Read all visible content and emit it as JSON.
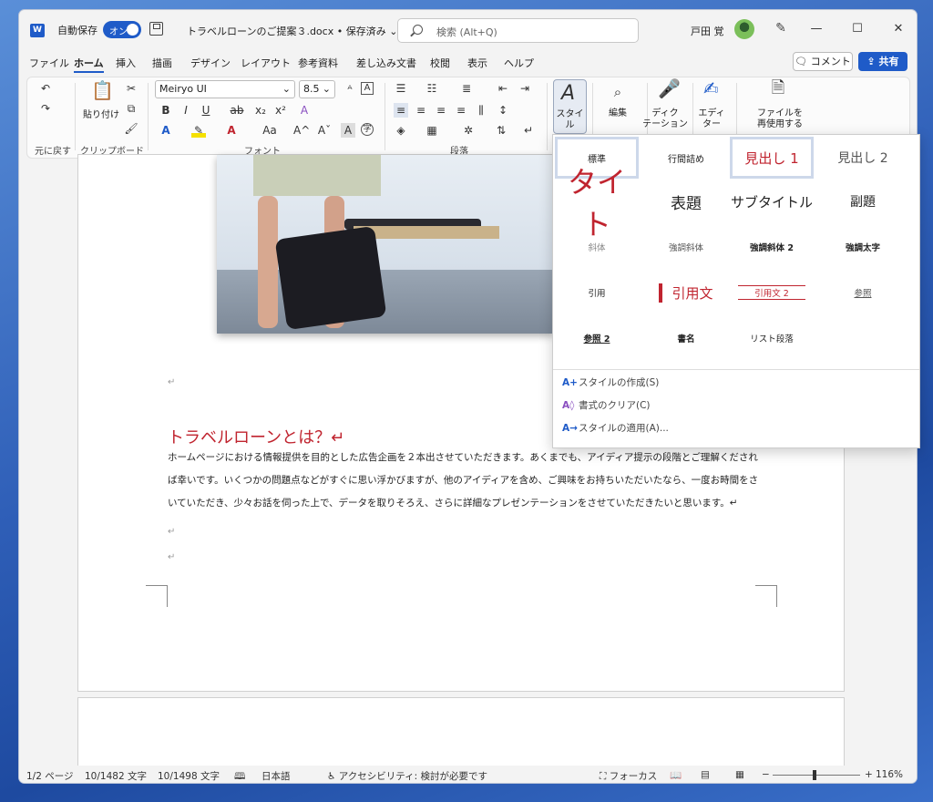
{
  "app": {
    "logo": "W",
    "autosave_label": "自動保存",
    "autosave_state": "オン",
    "doc_title": "トラベルローンのご提案３.docx • 保存済み ⌄",
    "search_placeholder": "検索 (Alt+Q)",
    "user_name": "戸田 覚"
  },
  "tabs": [
    "ファイル",
    "ホーム",
    "挿入",
    "描画",
    "デザイン",
    "レイアウト",
    "参考資料",
    "差し込み文書",
    "校閲",
    "表示",
    "ヘルプ"
  ],
  "actions": {
    "comment": "コメント",
    "share": "共有"
  },
  "ribbon": {
    "undo_group": "元に戻す",
    "paste_label": "貼り付け",
    "clipboard_group": "クリップボード",
    "font_name": "Meiryo UI",
    "font_size": "8.5",
    "font_group": "フォント",
    "paragraph_group": "段落",
    "style_label": "スタイル",
    "edit_label": "編集",
    "dictation_label": "ディク\nテーション",
    "editor_label": "エディ\nター",
    "reuse_label": "ファイルを\n再使用する"
  },
  "styles": [
    [
      "標準",
      "行間詰め",
      "見出し 1",
      "見出し 2"
    ],
    [
      "タイト",
      "表題",
      "サブタイトル",
      "副題"
    ],
    [
      "斜体",
      "強調斜体",
      "強調斜体 2",
      "強調太字"
    ],
    [
      "引用",
      "引用文",
      "引用文 2",
      "参照"
    ],
    [
      "参照 2",
      "書名",
      "リスト段落",
      ""
    ]
  ],
  "gallery_commands": [
    "スタイルの作成(S)",
    "書式のクリア(C)",
    "スタイルの適用(A)..."
  ],
  "document": {
    "heading": "トラベルローンとは？↵",
    "body": "ホームページにおける情報提供を目的とした広告企画を２本出させていただきます。あくまでも、アイディア提示の段階とご理解くだされば幸いです。いくつかの問題点などがすぐに思い浮かびますが、他のアイディアを含め、ご興味をお持ちいただいたなら、一度お時間をさいていただき、少々お話を伺った上で、データを取りそろえ、さらに詳細なプレゼンテーションをさせていただきたいと思います。↵",
    "para_mark": "↵"
  },
  "status": {
    "page": "1/2 ページ",
    "words1": "10/1482 文字",
    "words2": "10/1498 文字",
    "language": "日本語",
    "accessibility": "アクセシビリティ: 検討が必要です",
    "focus": "フォーカス",
    "zoom": "116%"
  },
  "colors": {
    "accent": "#1f5bc8",
    "heading_red": "#c0242f"
  }
}
